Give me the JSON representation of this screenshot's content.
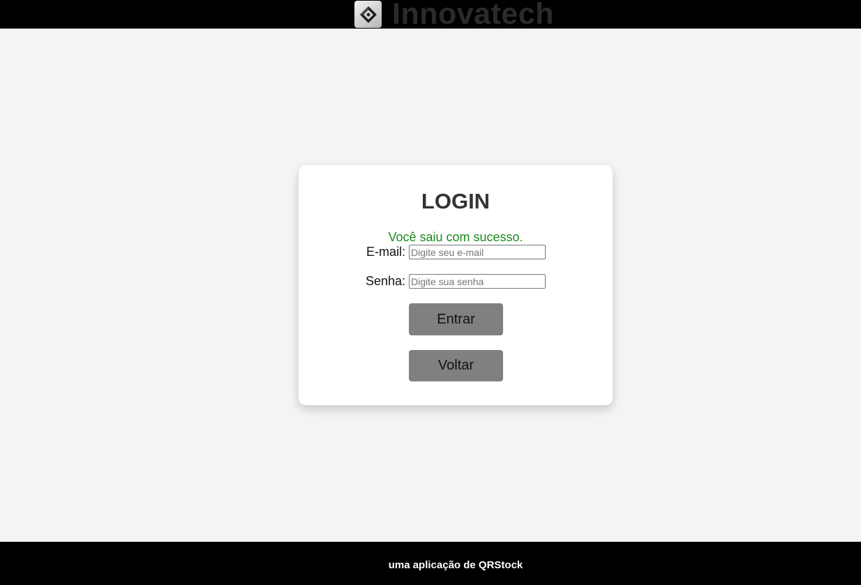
{
  "header": {
    "brand_name": "Innovatech",
    "logo_icon": "diamond-logo-icon"
  },
  "login": {
    "title": "LOGIN",
    "message": "Você saiu com sucesso.",
    "email_label": "E-mail:",
    "email_value": "",
    "email_placeholder": "Digite seu e-mail",
    "password_label": "Senha:",
    "password_value": "",
    "password_placeholder": "Digite sua senha",
    "submit_label": "Entrar",
    "back_label": "Voltar"
  },
  "footer": {
    "text": "uma aplicação de QRStock"
  },
  "colors": {
    "header_bg": "#000000",
    "page_bg": "#f4f4f4",
    "button_bg": "#808080",
    "success_text": "#1a8a1a"
  }
}
